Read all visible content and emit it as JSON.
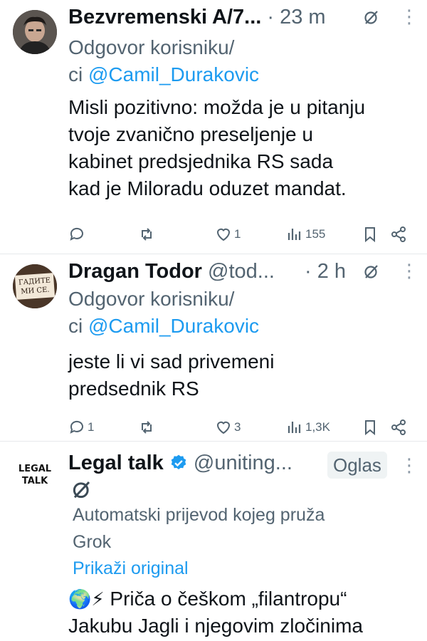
{
  "tweets": [
    {
      "name": "Bezvremenski A/7...",
      "time": "· 23 m",
      "reply_line1": "Odgovor korisniku/",
      "reply_prefix": "ci ",
      "reply_mention": "@Camil_Durakovic",
      "text_lines": [
        "Misli pozitivno: možda je u pitanju",
        "tvoje zvanično preseljenje u",
        "kabinet predsjednika RS sada",
        "kad je Miloradu oduzet mandat."
      ],
      "replies": "",
      "likes": "1",
      "views": "155"
    },
    {
      "name": "Dragan Todor",
      "handle": "@tod...",
      "time": "· 2 h",
      "avatar_sign": [
        "ГАДИТЕ",
        "МИ СЕ."
      ],
      "reply_line1": "Odgovor korisniku/",
      "reply_prefix": "ci ",
      "reply_mention": "@Camil_Durakovic",
      "text_lines": [
        "jeste li vi sad privemeni",
        "predsednik RS"
      ],
      "replies": "1",
      "likes": "3",
      "views": "1,3K"
    },
    {
      "name": "Legal talk",
      "handle": "@uniting...",
      "ad_label": "Oglas",
      "logo_lines": [
        "LEGAL",
        "TALK"
      ],
      "grok_lines": [
        "Automatski prijevod kojeg pruža",
        "Grok"
      ],
      "show_original": "Prikaži original",
      "emojis": "🌍⚡",
      "text_lines": [
        "Priča o češkom „filantropu“",
        "Jakubu Jagli i njegovim zločinima"
      ]
    }
  ],
  "colors": {
    "accent": "#1d9bf0",
    "muted": "#536471",
    "verified": "#1d9bf0"
  }
}
